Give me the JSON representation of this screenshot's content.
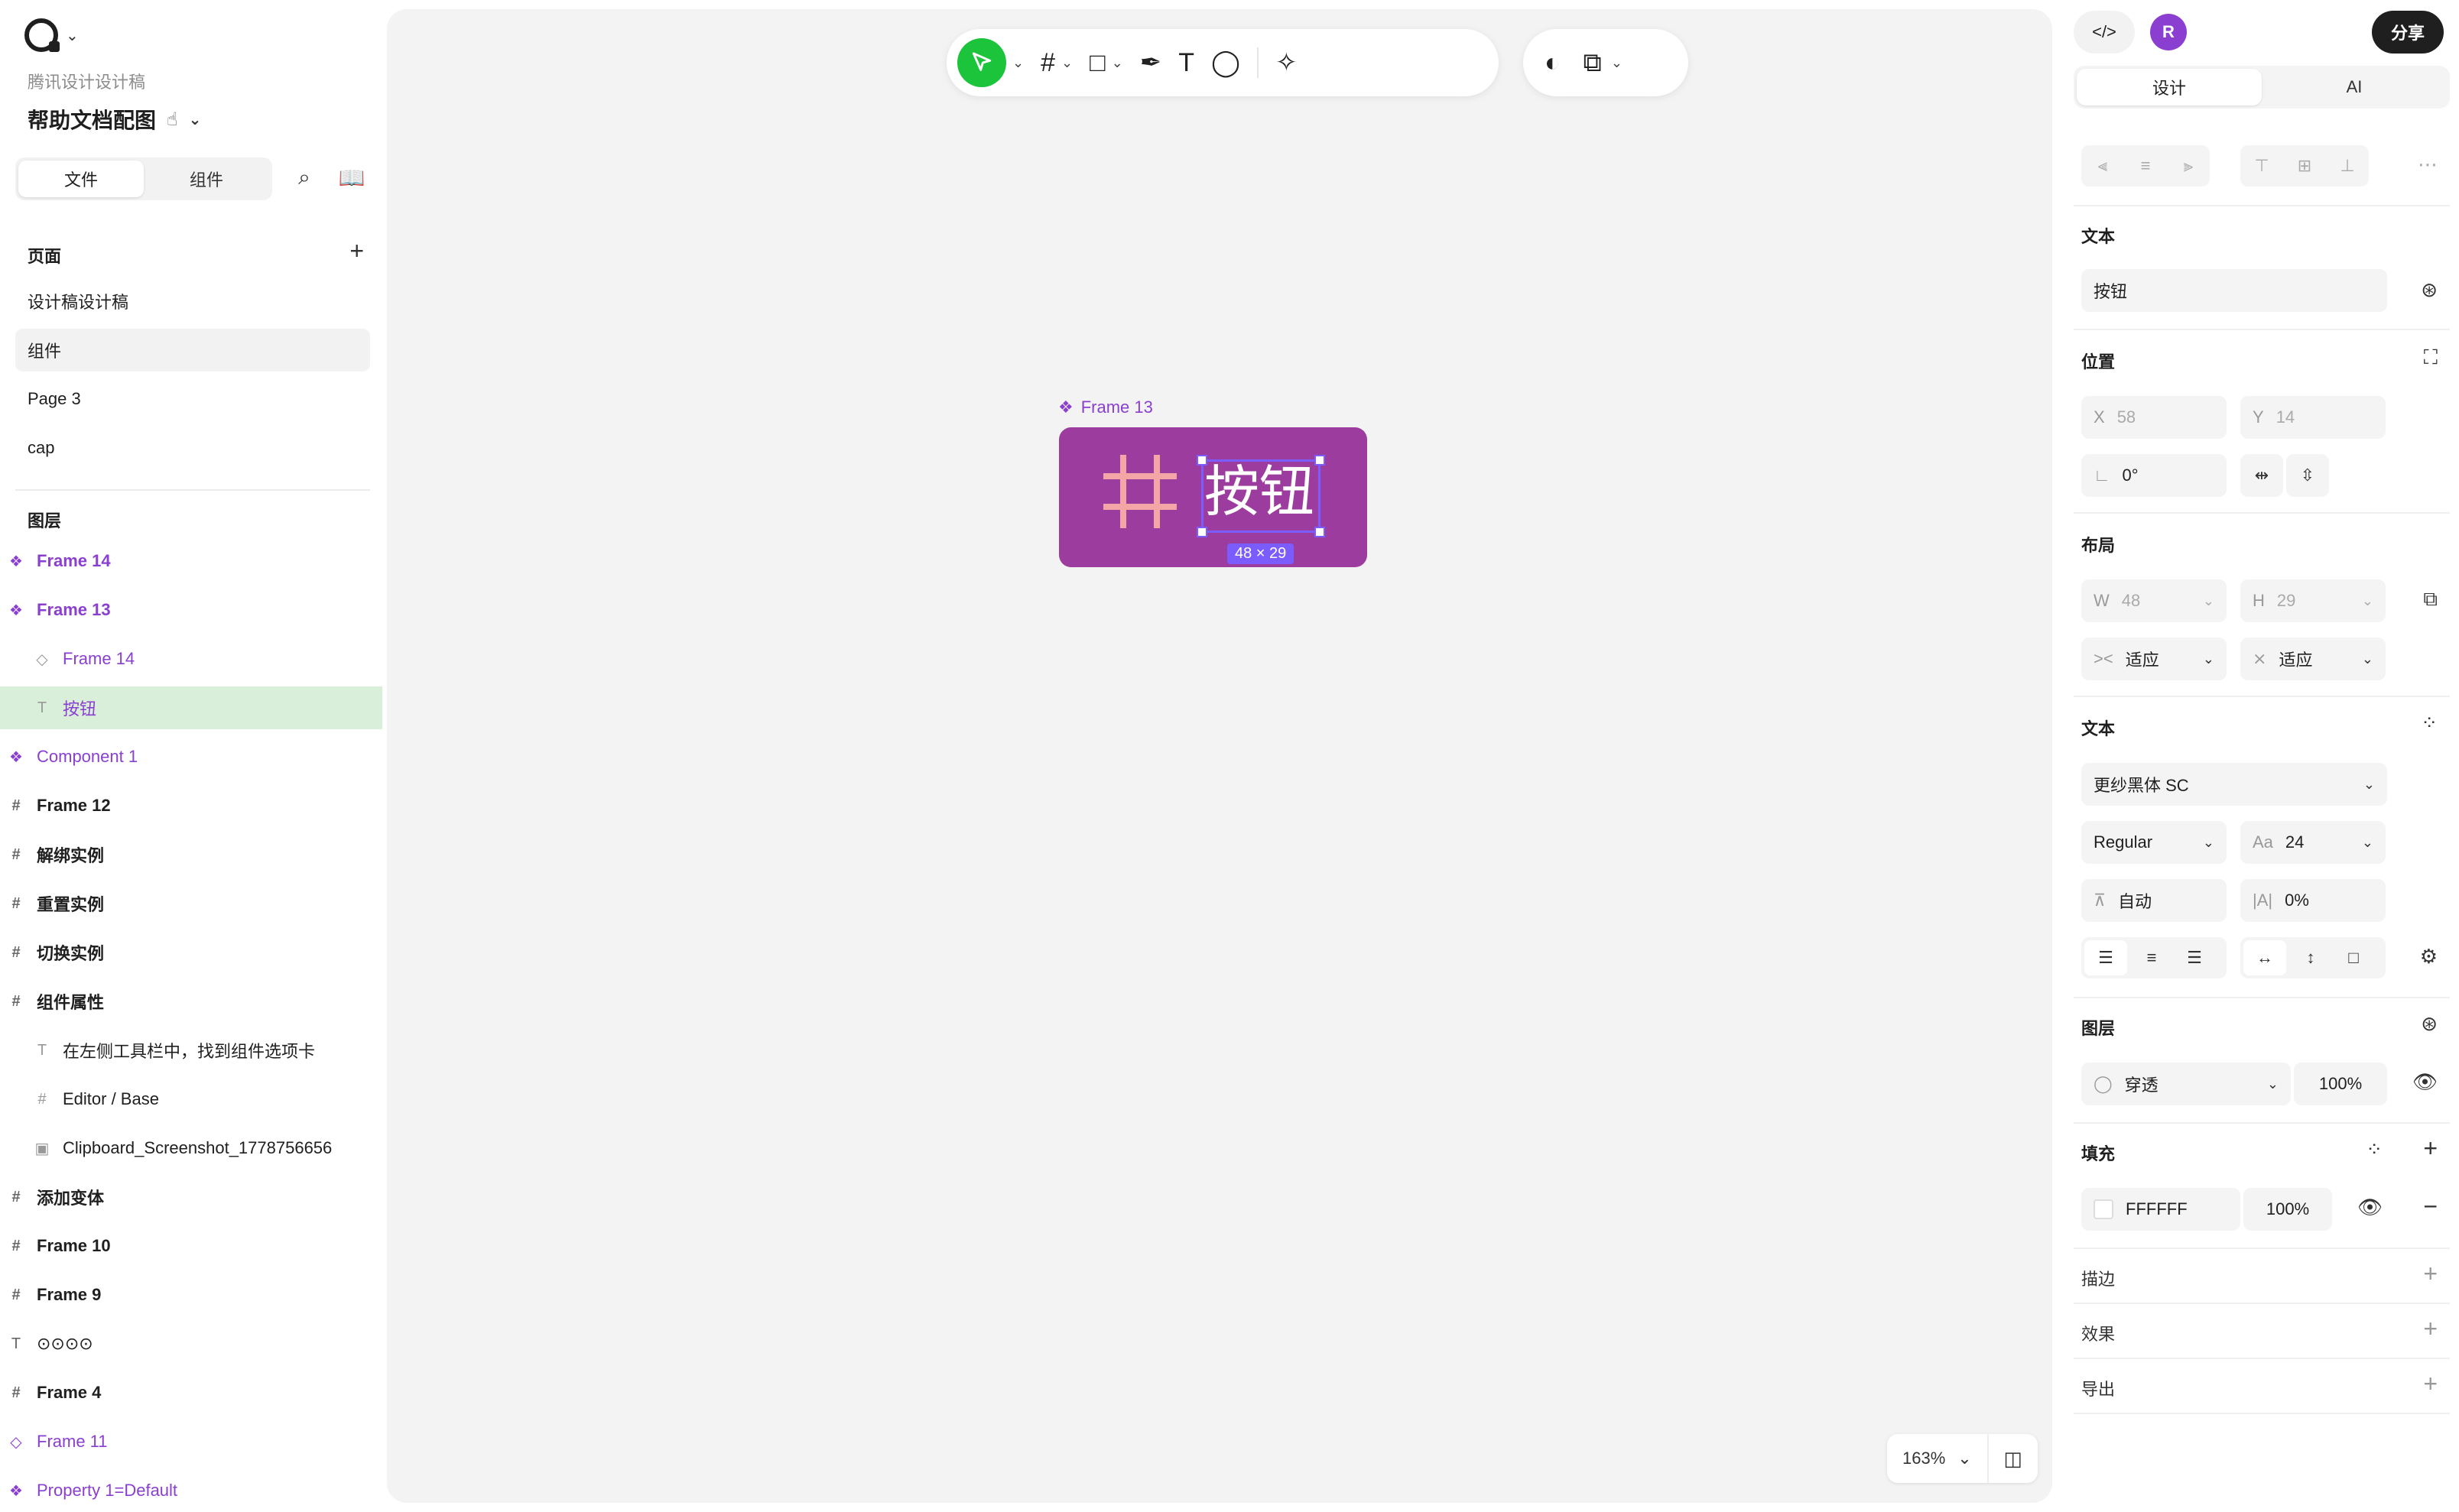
{
  "app": {
    "team": "腾讯设计设计稿",
    "doc_title": "帮助文档配图"
  },
  "left_tabs": {
    "files": "文件",
    "components": "组件"
  },
  "pages": {
    "header": "页面",
    "items": [
      {
        "label": "设计稿设计稿"
      },
      {
        "label": "组件"
      },
      {
        "label": "Page 3"
      },
      {
        "label": "cap"
      }
    ]
  },
  "layers": {
    "header": "图层",
    "items": [
      {
        "label": "Frame 14"
      },
      {
        "label": "Frame 13"
      },
      {
        "label": "Frame 14"
      },
      {
        "label": "按钮"
      },
      {
        "label": "Component 1"
      },
      {
        "label": "Frame 12"
      },
      {
        "label": "解绑实例"
      },
      {
        "label": "重置实例"
      },
      {
        "label": "切换实例"
      },
      {
        "label": "组件属性"
      },
      {
        "label": "在左侧工具栏中，找到组件选项卡"
      },
      {
        "label": "Editor / Base"
      },
      {
        "label": "Clipboard_Screenshot_1778756656"
      },
      {
        "label": "添加变体"
      },
      {
        "label": "Frame 10"
      },
      {
        "label": "Frame 9"
      },
      {
        "label": "⊙⊙⊙⊙"
      },
      {
        "label": "Frame 4"
      },
      {
        "label": "Frame 11"
      },
      {
        "label": "Property 1=Default"
      }
    ]
  },
  "canvas": {
    "frame_label": "Frame 13",
    "button_text": "按钮",
    "dimensions": "48 × 29",
    "frame_color": "#9B3C9E",
    "zoom": "163%"
  },
  "right": {
    "avatar": "R",
    "share": "分享",
    "tabs": {
      "design": "设计",
      "ai": "AI"
    },
    "text_section": "文本",
    "text_value": "按钮",
    "position_section": "位置",
    "x_label": "X",
    "x_value": "58",
    "y_label": "Y",
    "y_value": "14",
    "rotation": "0°",
    "layout_section": "布局",
    "w_label": "W",
    "w_value": "48",
    "h_label": "H",
    "h_value": "29",
    "fit_h": "适应",
    "fit_v": "适应",
    "typography_section": "文本",
    "font_family": "更纱黑体 SC",
    "font_weight": "Regular",
    "font_size": "24",
    "line_height": "自动",
    "letter_spacing": "0%",
    "layer_section": "图层",
    "blend_mode": "穿透",
    "opacity": "100%",
    "fill_section": "填充",
    "fill_hex": "FFFFFF",
    "fill_opacity": "100%",
    "stroke_section": "描边",
    "effects_section": "效果",
    "export_section": "导出"
  }
}
